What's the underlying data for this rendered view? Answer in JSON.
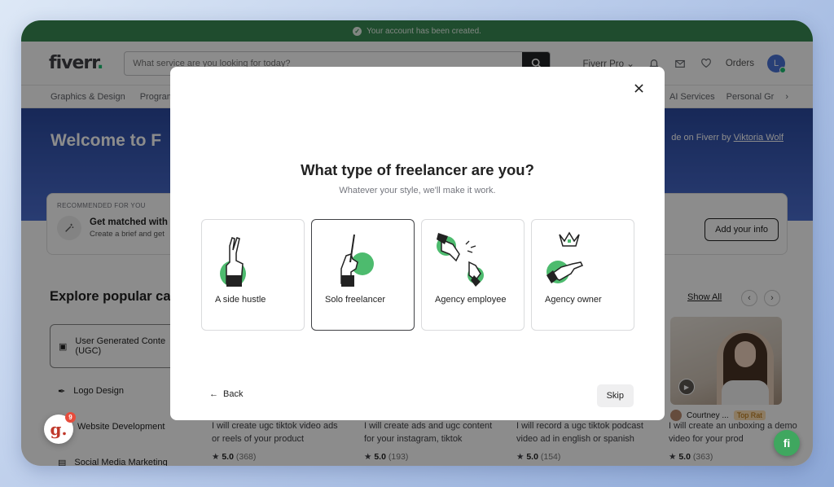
{
  "banner": {
    "text": "Your account has been created."
  },
  "header": {
    "logo": "fiverr",
    "logo_dot": ".",
    "search_placeholder": "What service are you looking for today?",
    "fiverr_pro": "Fiverr Pro",
    "orders": "Orders",
    "avatar_letter": "L"
  },
  "categories": {
    "left": [
      "Graphics & Design",
      "Program"
    ],
    "right": [
      "AI Services",
      "Personal Gr"
    ]
  },
  "hero": {
    "title": "Welcome to F",
    "credit_prefix": "de on Fiverr by",
    "credit_name": "Viktoria Wolf"
  },
  "recommended": {
    "label": "RECOMMENDED FOR YOU",
    "title": "Get matched with",
    "subtitle": "Create a brief and get",
    "add_info": "Add your info"
  },
  "explore": {
    "title": "Explore popular ca",
    "show_all": "Show All",
    "items": [
      {
        "label": "User Generated Conte",
        "label2": "(UGC)"
      },
      {
        "label": "Logo Design"
      },
      {
        "label": "Website Development"
      },
      {
        "label": "Social Media Marketing"
      }
    ]
  },
  "gigs": [
    {
      "text": "I will create ugc tiktok video ads or reels of your product",
      "rating": "5.0",
      "count": "(368)"
    },
    {
      "text": "I will create ads and ugc content for your instagram, tiktok",
      "rating": "5.0",
      "count": "(193)"
    },
    {
      "text": "I will record a ugc tiktok podcast video ad in english or spanish",
      "rating": "5.0",
      "count": "(154)"
    },
    {
      "text": "I will create an unboxing a demo video for your prod",
      "rating": "5.0",
      "count": "(363)"
    }
  ],
  "seller": {
    "name": "Courtney ...",
    "badge": "Top Rat"
  },
  "g_badge": {
    "letter": "g.",
    "count": "9"
  },
  "fab": {
    "letter": "fi"
  },
  "modal": {
    "title": "What type of freelancer are you?",
    "subtitle": "Whatever your style, we'll make it work.",
    "options": [
      {
        "label": "A side hustle",
        "icon": "peace-hand-icon"
      },
      {
        "label": "Solo freelancer",
        "icon": "pen-hand-icon",
        "selected": true
      },
      {
        "label": "Agency employee",
        "icon": "handshake-icon"
      },
      {
        "label": "Agency owner",
        "icon": "crown-hand-icon"
      }
    ],
    "back": "Back",
    "skip": "Skip"
  }
}
